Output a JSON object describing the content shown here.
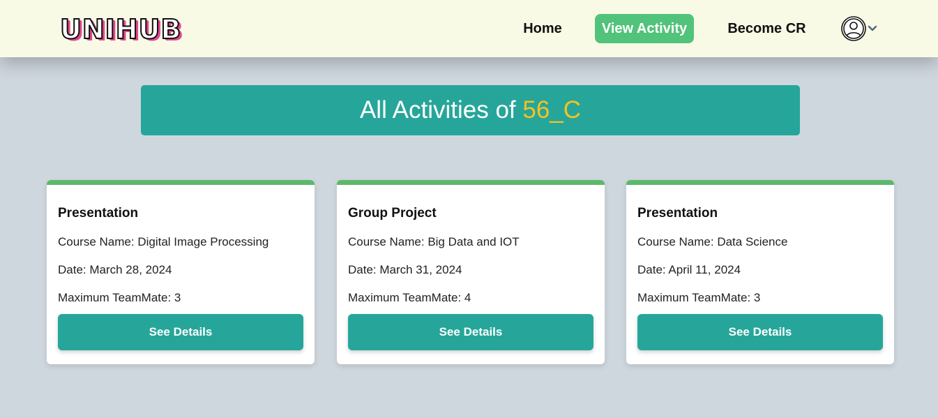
{
  "nav": {
    "logo": "UNIHUB",
    "items": [
      {
        "label": "Home"
      },
      {
        "label": "View Activity",
        "active": true
      },
      {
        "label": "Become CR"
      }
    ],
    "profile_icon": "user-circle-icon",
    "dropdown_icon": "chevron-down-icon",
    "active_color": "#52c37a",
    "brand_accent": "#e3478d"
  },
  "banner": {
    "prefix": "All Activities of ",
    "section": "56_C",
    "bg_color": "#26a69a",
    "highlight_color": "#f6c220"
  },
  "cards": [
    {
      "title": "Presentation",
      "course": "Course Name: Digital Image Processing",
      "date": "Date: March 28, 2024",
      "max": "Maximum TeamMate: 3",
      "button": "See Details"
    },
    {
      "title": "Group Project",
      "course": "Course Name: Big Data and IOT",
      "date": "Date: March 31, 2024",
      "max": "Maximum TeamMate: 4",
      "button": "See Details"
    },
    {
      "title": "Presentation",
      "course": "Course Name: Data Science",
      "date": "Date: April 11, 2024",
      "max": "Maximum TeamMate: 3",
      "button": "See Details"
    }
  ]
}
